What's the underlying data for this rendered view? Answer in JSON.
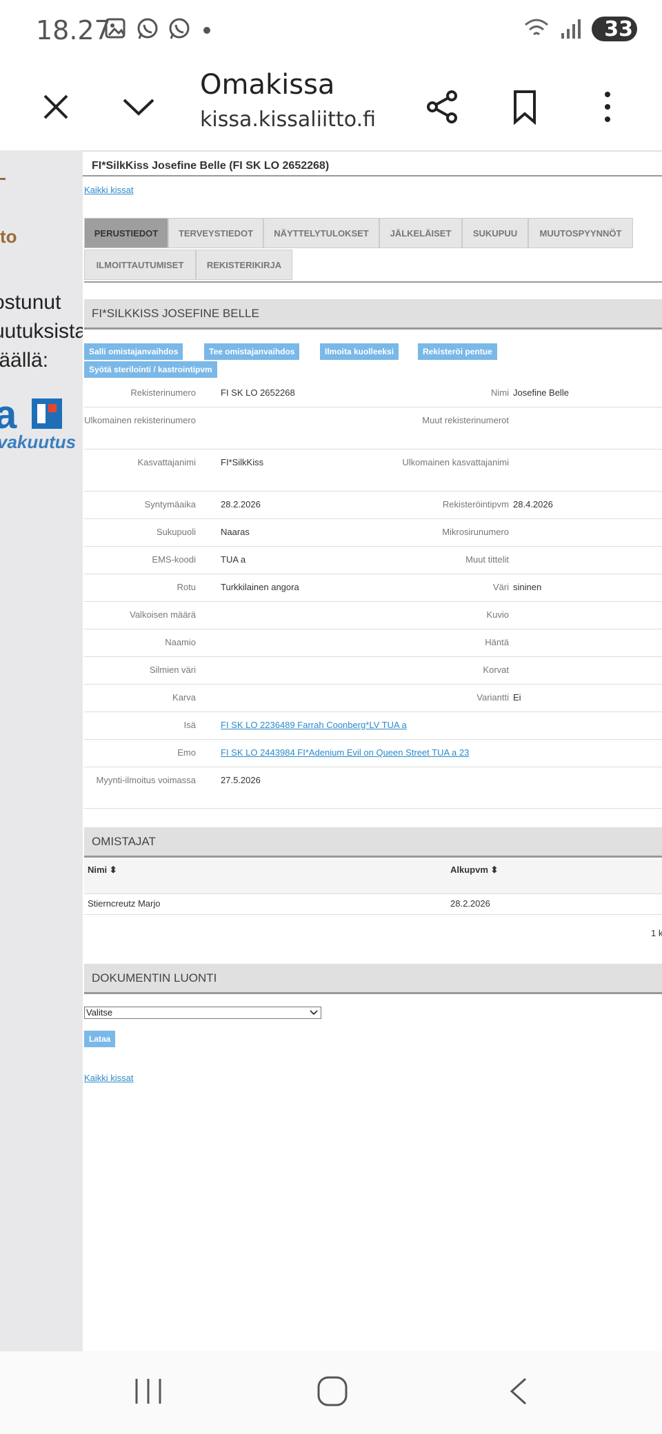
{
  "status": {
    "time": "18.27",
    "battery": "33"
  },
  "browser": {
    "title": "Omakissa",
    "url": "kissa.kissaliitto.fi"
  },
  "ad": {
    "line1": "to",
    "line2a": "ostunut",
    "line2b": "uutuksista?",
    "line2c": "täällä:",
    "logo_text": "a",
    "brand": "vakuutus"
  },
  "page": {
    "title": "FI*SilkKiss Josefine Belle (FI SK LO 2652268)",
    "back_link": "Kaikki kissat",
    "back_link_bottom": "Kaikki kissat"
  },
  "tabs": [
    "PERUSTIEDOT",
    "TERVEYSTIEDOT",
    "NÄYTTELYTULOKSET",
    "JÄLKELÄISET",
    "SUKUPUU",
    "MUUTOSPYYNNÖT",
    "ILMOITTAUTUMISET",
    "REKISTERIKIRJA"
  ],
  "basic": {
    "header": "FI*SILKKISS JOSEFINE BELLE",
    "actions": [
      "Salli omistajanvaihdos",
      "Tee omistajanvaihdos",
      "Ilmoita kuolleeksi",
      "Rekisteröi pentue",
      "Syötä sterilointi / kastrointipvm"
    ],
    "rows": [
      {
        "l1": "Rekisterinumero",
        "v1": "FI SK LO 2652268",
        "l2": "Nimi",
        "v2": "Josefine Belle"
      },
      {
        "l1": "Ulkomainen rekisterinumero",
        "v1": "",
        "l2": "Muut rekisterinumerot",
        "v2": ""
      },
      {
        "l1": "Kasvattajanimi",
        "v1": "FI*SilkKiss",
        "l2": "Ulkomainen kasvattajanimi",
        "v2": ""
      },
      {
        "l1": "Syntymäaika",
        "v1": "28.2.2026",
        "l2": "Rekisteröintipvm",
        "v2": "28.4.2026"
      },
      {
        "l1": "Sukupuoli",
        "v1": "Naaras",
        "l2": "Mikrosirunumero",
        "v2": ""
      },
      {
        "l1": "EMS-koodi",
        "v1": "TUA a",
        "l2": "Muut tittelit",
        "v2": ""
      },
      {
        "l1": "Rotu",
        "v1": "Turkkilainen angora",
        "l2": "Väri",
        "v2": "sininen"
      },
      {
        "l1": "Valkoisen määrä",
        "v1": "",
        "l2": "Kuvio",
        "v2": ""
      },
      {
        "l1": "Naamio",
        "v1": "",
        "l2": "Häntä",
        "v2": ""
      },
      {
        "l1": "Silmien väri",
        "v1": "",
        "l2": "Korvat",
        "v2": ""
      },
      {
        "l1": "Karva",
        "v1": "",
        "l2": "Variantti",
        "v2": "Ei"
      },
      {
        "l1": "Isä",
        "v1": "FI SK LO 2236489 Farrah Coonberg*LV TUA a",
        "l2": "",
        "v2": ""
      },
      {
        "l1": "Emo",
        "v1": "FI SK LO 2443984 FI*Adenium Evil on Queen Street TUA a 23",
        "l2": "",
        "v2": ""
      },
      {
        "l1": "Myynti-ilmoitus voimassa",
        "v1": "27.5.2026",
        "l2": "",
        "v2": ""
      }
    ]
  },
  "owners": {
    "header": "OMISTAJAT",
    "col_name": "Nimi",
    "col_start": "Alkupvm",
    "rows": [
      {
        "name": "Stierncreutz Marjo",
        "start": "28.2.2026"
      }
    ],
    "pager": "1 k"
  },
  "document": {
    "header": "DOKUMENTIN LUONTI",
    "select_value": "Valitse",
    "button": "Lataa"
  }
}
